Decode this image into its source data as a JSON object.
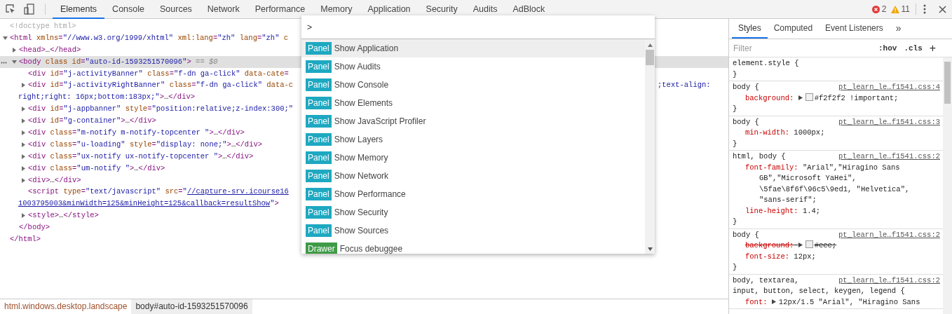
{
  "toolbar": {
    "tabs": [
      {
        "label": "Elements",
        "selected": true
      },
      {
        "label": "Console",
        "selected": false
      },
      {
        "label": "Sources",
        "selected": false
      },
      {
        "label": "Network",
        "selected": false
      },
      {
        "label": "Performance",
        "selected": false
      },
      {
        "label": "Memory",
        "selected": false
      },
      {
        "label": "Application",
        "selected": false
      },
      {
        "label": "Security",
        "selected": false
      },
      {
        "label": "Audits",
        "selected": false
      },
      {
        "label": "AdBlock",
        "selected": false
      }
    ],
    "errors": "2",
    "warnings": "11"
  },
  "elements": {
    "nodes": [
      {
        "selected": false,
        "segs": [
          {
            "kind": "comment",
            "text": "<!doctype html>"
          }
        ]
      },
      {
        "selected": false,
        "expanded": true,
        "segs": [
          {
            "kind": "tag",
            "text": "<html "
          },
          {
            "kind": "attr",
            "text": "xmlns"
          },
          {
            "kind": "tag",
            "text": "="
          },
          {
            "kind": "value",
            "text": "\"//www.w3.org/1999/xhtml\""
          },
          {
            "kind": "attr",
            "text": " xml:lang"
          },
          {
            "kind": "tag",
            "text": "="
          },
          {
            "kind": "value",
            "text": "\"zh\""
          },
          {
            "kind": "attr",
            "text": " lang"
          },
          {
            "kind": "tag",
            "text": "="
          },
          {
            "kind": "value",
            "text": "\"zh\""
          },
          {
            "kind": "attr",
            "text": " c"
          }
        ],
        "children": [
          {
            "selected": false,
            "expanded": false,
            "segs": [
              {
                "kind": "tag",
                "text": "<head>"
              },
              {
                "kind": "text",
                "text": "…"
              },
              {
                "kind": "tag",
                "text": "</head>"
              }
            ]
          },
          {
            "selected": true,
            "expanded": true,
            "segs": [
              {
                "kind": "tag",
                "text": "<body "
              },
              {
                "kind": "attr",
                "text": "class id"
              },
              {
                "kind": "tag",
                "text": "="
              },
              {
                "kind": "value",
                "text": "\"auto-id-1593251570096\""
              },
              {
                "kind": "tag",
                "text": ">"
              },
              {
                "kind": "note",
                "text": " == $0"
              }
            ],
            "children": [
              {
                "selected": false,
                "segs": [
                  {
                    "kind": "tag",
                    "text": "<div "
                  },
                  {
                    "kind": "attr",
                    "text": "id"
                  },
                  {
                    "kind": "tag",
                    "text": "="
                  },
                  {
                    "kind": "value",
                    "text": "\"j-activityBanner\""
                  },
                  {
                    "kind": "attr",
                    "text": " class"
                  },
                  {
                    "kind": "tag",
                    "text": "="
                  },
                  {
                    "kind": "value",
                    "text": "\"f-dn ga-click\""
                  },
                  {
                    "kind": "attr",
                    "text": " data-cate"
                  },
                  {
                    "kind": "tag",
                    "text": "="
                  }
                ]
              },
              {
                "selected": false,
                "expanded": false,
                "segs": [
                  {
                    "kind": "tag",
                    "text": "<div "
                  },
                  {
                    "kind": "attr",
                    "text": "id"
                  },
                  {
                    "kind": "tag",
                    "text": "="
                  },
                  {
                    "kind": "value",
                    "text": "\"j-activityRightBanner\""
                  },
                  {
                    "kind": "attr",
                    "text": " class"
                  },
                  {
                    "kind": "tag",
                    "text": "="
                  },
                  {
                    "kind": "value",
                    "text": "\"f-dn ga-click\""
                  },
                  {
                    "kind": "attr",
                    "text": " data-c"
                  }
                ],
                "tail": ";text-align:",
                "wrap": [
                  {
                    "kind": "value",
                    "text": "right;right: 16px;bottom:183px;\""
                  },
                  {
                    "kind": "tag",
                    "text": ">"
                  },
                  {
                    "kind": "text",
                    "text": "…"
                  },
                  {
                    "kind": "tag",
                    "text": "</div>"
                  }
                ]
              },
              {
                "selected": false,
                "expanded": false,
                "segs": [
                  {
                    "kind": "tag",
                    "text": "<div "
                  },
                  {
                    "kind": "attr",
                    "text": "id"
                  },
                  {
                    "kind": "tag",
                    "text": "="
                  },
                  {
                    "kind": "value",
                    "text": "\"j-appbanner\""
                  },
                  {
                    "kind": "attr",
                    "text": " style"
                  },
                  {
                    "kind": "tag",
                    "text": "="
                  },
                  {
                    "kind": "value",
                    "text": "\"position:relative;z-index:300;\""
                  }
                ]
              },
              {
                "selected": false,
                "expanded": false,
                "segs": [
                  {
                    "kind": "tag",
                    "text": "<div "
                  },
                  {
                    "kind": "attr",
                    "text": "id"
                  },
                  {
                    "kind": "tag",
                    "text": "="
                  },
                  {
                    "kind": "value",
                    "text": "\"g-container\""
                  },
                  {
                    "kind": "tag",
                    "text": ">"
                  },
                  {
                    "kind": "text",
                    "text": "…"
                  },
                  {
                    "kind": "tag",
                    "text": "</div>"
                  }
                ]
              },
              {
                "selected": false,
                "expanded": false,
                "segs": [
                  {
                    "kind": "tag",
                    "text": "<div "
                  },
                  {
                    "kind": "attr",
                    "text": "class"
                  },
                  {
                    "kind": "tag",
                    "text": "="
                  },
                  {
                    "kind": "value",
                    "text": "\"m-notify m-notify-topcenter \""
                  },
                  {
                    "kind": "tag",
                    "text": ">"
                  },
                  {
                    "kind": "text",
                    "text": "…"
                  },
                  {
                    "kind": "tag",
                    "text": "</div>"
                  }
                ]
              },
              {
                "selected": false,
                "expanded": false,
                "segs": [
                  {
                    "kind": "tag",
                    "text": "<div "
                  },
                  {
                    "kind": "attr",
                    "text": "class"
                  },
                  {
                    "kind": "tag",
                    "text": "="
                  },
                  {
                    "kind": "value",
                    "text": "\"u-loading\""
                  },
                  {
                    "kind": "attr",
                    "text": " style"
                  },
                  {
                    "kind": "tag",
                    "text": "="
                  },
                  {
                    "kind": "value",
                    "text": "\"display: none;\""
                  },
                  {
                    "kind": "tag",
                    "text": ">"
                  },
                  {
                    "kind": "text",
                    "text": "…"
                  },
                  {
                    "kind": "tag",
                    "text": "</div>"
                  }
                ]
              },
              {
                "selected": false,
                "expanded": false,
                "segs": [
                  {
                    "kind": "tag",
                    "text": "<div "
                  },
                  {
                    "kind": "attr",
                    "text": "class"
                  },
                  {
                    "kind": "tag",
                    "text": "="
                  },
                  {
                    "kind": "value",
                    "text": "\"ux-notify ux-notify-topcenter \""
                  },
                  {
                    "kind": "tag",
                    "text": ">"
                  },
                  {
                    "kind": "text",
                    "text": "…"
                  },
                  {
                    "kind": "tag",
                    "text": "</div>"
                  }
                ]
              },
              {
                "selected": false,
                "expanded": false,
                "segs": [
                  {
                    "kind": "tag",
                    "text": "<div "
                  },
                  {
                    "kind": "attr",
                    "text": "class"
                  },
                  {
                    "kind": "tag",
                    "text": "="
                  },
                  {
                    "kind": "value",
                    "text": "\"um-notify \""
                  },
                  {
                    "kind": "tag",
                    "text": ">"
                  },
                  {
                    "kind": "text",
                    "text": "…"
                  },
                  {
                    "kind": "tag",
                    "text": "</div>"
                  }
                ]
              },
              {
                "selected": false,
                "expanded": false,
                "segs": [
                  {
                    "kind": "tag",
                    "text": "<div>"
                  },
                  {
                    "kind": "text",
                    "text": "…"
                  },
                  {
                    "kind": "tag",
                    "text": "</div>"
                  }
                ]
              },
              {
                "selected": false,
                "segs": [
                  {
                    "kind": "tag",
                    "text": "<script "
                  },
                  {
                    "kind": "attr",
                    "text": "type"
                  },
                  {
                    "kind": "tag",
                    "text": "="
                  },
                  {
                    "kind": "value",
                    "text": "\"text/javascript\""
                  },
                  {
                    "kind": "attr",
                    "text": " src"
                  },
                  {
                    "kind": "tag",
                    "text": "="
                  },
                  {
                    "kind": "value",
                    "text": "\""
                  },
                  {
                    "kind": "link",
                    "text": "//capture-srv.icourse16"
                  }
                ],
                "wrap": [
                  {
                    "kind": "link",
                    "text": "1003795003&minWidth=125&minHeight=125&callback=resultShow"
                  },
                  {
                    "kind": "value",
                    "text": "\""
                  },
                  {
                    "kind": "tag",
                    "text": ">"
                  }
                ]
              },
              {
                "selected": false,
                "expanded": false,
                "segs": [
                  {
                    "kind": "tag",
                    "text": "<style>"
                  },
                  {
                    "kind": "text",
                    "text": "…"
                  },
                  {
                    "kind": "tag",
                    "text": "</style>"
                  }
                ]
              }
            ],
            "close": [
              {
                "kind": "tag",
                "text": "</body>"
              }
            ]
          }
        ],
        "close": [
          {
            "kind": "tag",
            "text": "</html>"
          }
        ]
      }
    ]
  },
  "command_menu": {
    "value": ">",
    "items": [
      {
        "category": "Panel",
        "kind": "panel",
        "label": "Show Application",
        "selected": true
      },
      {
        "category": "Panel",
        "kind": "panel",
        "label": "Show Audits",
        "selected": false
      },
      {
        "category": "Panel",
        "kind": "panel",
        "label": "Show Console",
        "selected": false
      },
      {
        "category": "Panel",
        "kind": "panel",
        "label": "Show Elements",
        "selected": false
      },
      {
        "category": "Panel",
        "kind": "panel",
        "label": "Show JavaScript Profiler",
        "selected": false
      },
      {
        "category": "Panel",
        "kind": "panel",
        "label": "Show Layers",
        "selected": false
      },
      {
        "category": "Panel",
        "kind": "panel",
        "label": "Show Memory",
        "selected": false
      },
      {
        "category": "Panel",
        "kind": "panel",
        "label": "Show Network",
        "selected": false
      },
      {
        "category": "Panel",
        "kind": "panel",
        "label": "Show Performance",
        "selected": false
      },
      {
        "category": "Panel",
        "kind": "panel",
        "label": "Show Security",
        "selected": false
      },
      {
        "category": "Panel",
        "kind": "panel",
        "label": "Show Sources",
        "selected": false
      },
      {
        "category": "Drawer",
        "kind": "drawer",
        "label": "Focus debuggee",
        "selected": false
      }
    ]
  },
  "breadcrumbs": [
    {
      "label": "html.windows.desktop.landscape",
      "selected": false
    },
    {
      "label": "body#auto-id-1593251570096",
      "selected": true
    }
  ],
  "styles": {
    "tabs": [
      {
        "label": "Styles",
        "selected": true
      },
      {
        "label": "Computed",
        "selected": false
      },
      {
        "label": "Event Listeners",
        "selected": false
      }
    ],
    "more": "»",
    "filter": {
      "placeholder": "Filter"
    },
    "hov": ":hov",
    "cls": ".cls",
    "add": "+",
    "rules": [
      {
        "selector": [
          "element.style {"
        ],
        "close": "}"
      },
      {
        "selector": [
          "body {"
        ],
        "source": "pt_learn_le…f1541.css:4",
        "props": [
          {
            "name": "background:",
            "value": "#f2f2f2 !important;",
            "struck": false,
            "expandable": true,
            "color": "#f2f2f2"
          }
        ],
        "close": "}"
      },
      {
        "selector": [
          "body {"
        ],
        "source": "pt_learn_le…f1541.css:3",
        "props": [
          {
            "name": "min-width:",
            "value": "1000px;",
            "struck": false,
            "expandable": false
          }
        ],
        "close": "}"
      },
      {
        "selector": [
          "html, body {"
        ],
        "source": "pt_learn_le…f1541.css:2",
        "props": [
          {
            "name": "font-family:",
            "value": "\"Arial\",\"Hiragino Sans GB\",\"Microsoft YaHei\", \\5fae\\8f6f\\96c5\\9ed1, \"Helvetica\", \"sans-serif\";",
            "struck": false,
            "expandable": false
          },
          {
            "name": "line-height:",
            "value": "1.4;",
            "struck": false,
            "expandable": false
          }
        ],
        "close": "}"
      },
      {
        "selector": [
          "body {"
        ],
        "source": "pt_learn_le…f1541.css:2",
        "props": [
          {
            "name": "background:",
            "value": "#eee;",
            "struck": true,
            "expandable": true,
            "color": "#eeeeee"
          },
          {
            "name": "font-size:",
            "value": "12px;",
            "struck": false,
            "expandable": false
          }
        ],
        "close": "}"
      },
      {
        "selector": [
          "body, textarea,",
          "input, button, select, keygen, legend {"
        ],
        "source": "pt_learn_le…f1541.css:2",
        "props": [
          {
            "name": "font:",
            "value": "12px/1.5 \"Arial\", \"Hiragino Sans",
            "struck": false,
            "expandable": true
          }
        ]
      }
    ]
  }
}
